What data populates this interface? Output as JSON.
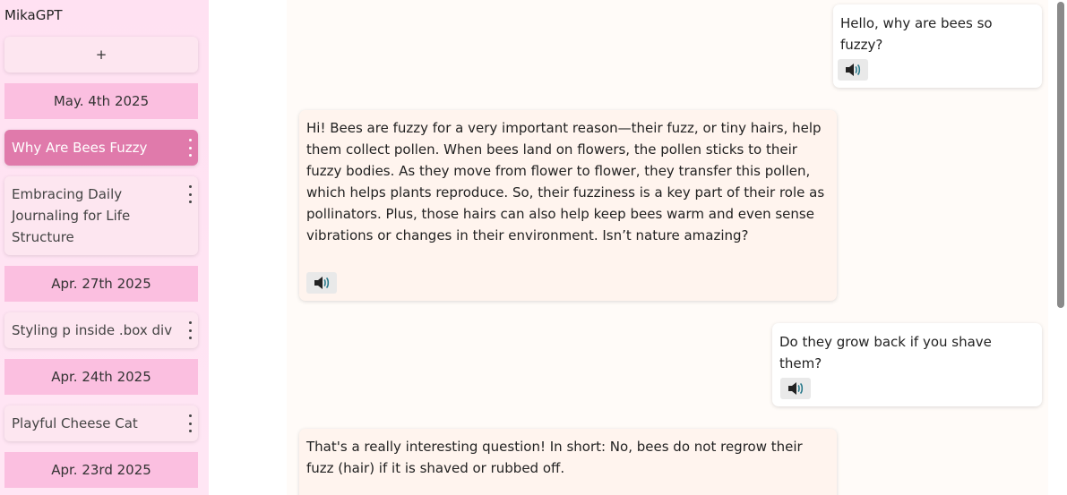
{
  "app_title": "MikaGPT",
  "new_chat_label": "+",
  "sidebar": {
    "groups": [
      {
        "date": "May. 4th 2025",
        "chats": [
          {
            "title": "Why Are Bees Fuzzy",
            "active": true
          },
          {
            "title": "Embracing Daily Journaling for Life Structure",
            "active": false
          }
        ]
      },
      {
        "date": "Apr. 27th 2025",
        "chats": [
          {
            "title": "Styling p inside .box div",
            "active": false
          }
        ]
      },
      {
        "date": "Apr. 24th 2025",
        "chats": [
          {
            "title": "Playful Cheese Cat",
            "active": false
          }
        ]
      },
      {
        "date": "Apr. 23rd 2025",
        "chats": []
      }
    ]
  },
  "messages": [
    {
      "role": "user",
      "text": "Hello, why are bees so fuzzy?"
    },
    {
      "role": "assistant",
      "text": "Hi! Bees are fuzzy for a very important reason—their fuzz, or tiny hairs, help them collect pollen. When bees land on flowers, the pollen sticks to their fuzzy bodies. As they move from flower to flower, they transfer this pollen, which helps plants reproduce. So, their fuzziness is a key part of their role as pollinators. Plus, those hairs can also help keep bees warm and even sense vibrations or changes in their environment. Isn’t nature amazing?"
    },
    {
      "role": "user",
      "text": "Do they grow back if you shave them?"
    },
    {
      "role": "assistant",
      "text": "That's a really interesting question! In short: No, bees do not regrow their fuzz (hair) if it is shaved or rubbed off."
    }
  ],
  "icons": {
    "speak": "speaker-icon",
    "menu": "kebab-menu-icon"
  },
  "colors": {
    "sidebar_bg": "#ffe1f2",
    "date_header": "#fbbfe0",
    "active_chat": "#e07aab",
    "speaker_accent": "#2a7a8c"
  }
}
